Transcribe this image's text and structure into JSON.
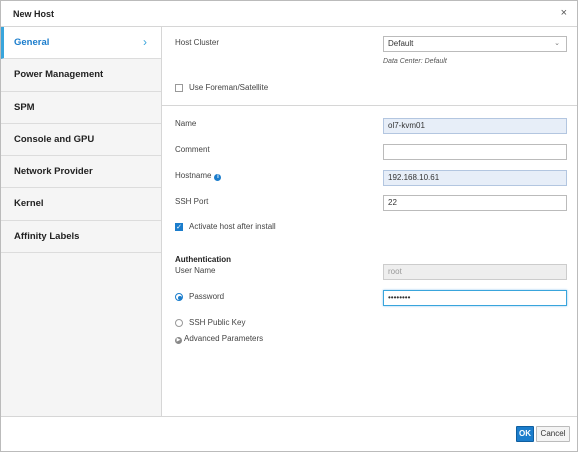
{
  "dialog": {
    "title": "New Host",
    "close_glyph": "×"
  },
  "sidebar": {
    "items": [
      {
        "label": "General",
        "active": true
      },
      {
        "label": "Power Management"
      },
      {
        "label": "SPM"
      },
      {
        "label": "Console and GPU"
      },
      {
        "label": "Network Provider"
      },
      {
        "label": "Kernel"
      },
      {
        "label": "Affinity Labels"
      }
    ],
    "active_chevron": "›"
  },
  "general": {
    "host_cluster": {
      "label": "Host Cluster",
      "value": "Default",
      "note": "Data Center: Default"
    },
    "use_foreman": {
      "label": "Use Foreman/Satellite",
      "checked": false
    },
    "name": {
      "label": "Name",
      "value": "ol7-kvm01"
    },
    "comment": {
      "label": "Comment",
      "value": ""
    },
    "hostname": {
      "label": "Hostname",
      "value": "192.168.10.61"
    },
    "ssh_port": {
      "label": "SSH Port",
      "value": "22"
    },
    "activate": {
      "label": "Activate host after install",
      "checked": true
    },
    "authentication": {
      "title": "Authentication",
      "user_name_label": "User Name",
      "user_name_value": "root",
      "password_label": "Password",
      "password_value": "••••••••",
      "password_selected": true,
      "ssh_key_label": "SSH Public Key"
    },
    "advanced": {
      "label": "Advanced Parameters"
    }
  },
  "footer": {
    "ok_label": "OK",
    "cancel_label": "Cancel"
  },
  "colors": {
    "accent": "#1b7dcc",
    "active_border": "#39a5dc",
    "filled_field": "#e7eef8"
  }
}
